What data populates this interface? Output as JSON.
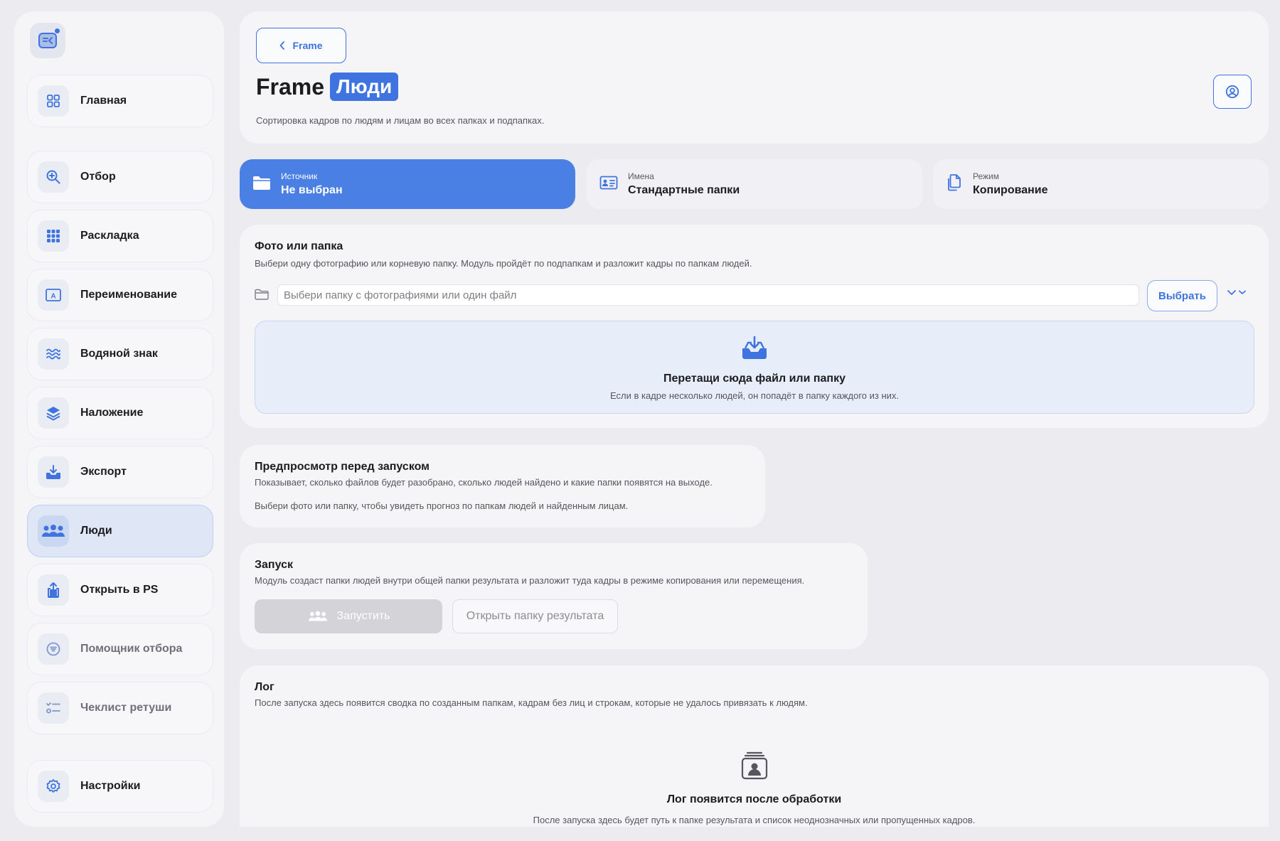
{
  "sidebar": {
    "items": [
      {
        "label": "Главная"
      },
      {
        "label": "Отбор"
      },
      {
        "label": "Раскладка"
      },
      {
        "label": "Переименование"
      },
      {
        "label": "Водяной знак"
      },
      {
        "label": "Наложение"
      },
      {
        "label": "Экспорт"
      },
      {
        "label": "Люди"
      },
      {
        "label": "Открыть в PS"
      },
      {
        "label": "Помощник отбора"
      },
      {
        "label": "Чеклист ретуши"
      },
      {
        "label": "Настройки"
      }
    ],
    "active_item": "Люди"
  },
  "header": {
    "back_label": "Frame",
    "title_main": "Frame",
    "title_badge": "Люди",
    "subtitle": "Сортировка кадров по людям и лицам во всех папках и подпапках."
  },
  "tiles": [
    {
      "caption": "Источник",
      "value": "Не выбран"
    },
    {
      "caption": "Имена",
      "value": "Стандартные папки"
    },
    {
      "caption": "Режим",
      "value": "Копирование"
    }
  ],
  "source": {
    "title": "Фото или папка",
    "description": "Выбери одну фотографию или корневую папку. Модуль пройдёт по подпапкам и разложит кадры по папкам людей.",
    "input_value": "",
    "input_placeholder": "Выбери папку с фотографиями или один файл",
    "choose_label": "Выбрать",
    "dropzone_title": "Перетащи сюда файл или папку",
    "dropzone_desc": "Если в кадре несколько людей, он попадёт в папку каждого из них."
  },
  "preview": {
    "title": "Предпросмотр перед запуском",
    "description": "Показывает, сколько файлов будет разобрано, сколько людей найдено и какие папки появятся на выходе.",
    "hint": "Выбери фото или папку, чтобы увидеть прогноз по папкам людей и найденным лицам."
  },
  "launch": {
    "title": "Запуск",
    "description": "Модуль создаст папки людей внутри общей папки результата и разложит туда кадры в режиме копирования или перемещения.",
    "run_label": "Запустить",
    "open_label": "Открыть папку результата"
  },
  "log": {
    "title": "Лог",
    "description": "После запуска здесь появится сводка по созданным папкам, кадрам без лиц и строкам, которые не удалось привязать к людям.",
    "empty_title": "Лог появится после обработки",
    "empty_desc": "После запуска здесь будет путь к папке результата и список неоднозначных или пропущенных кадров."
  },
  "colors": {
    "accent": "#3f74e0",
    "tile_primary": "#4a7fe3",
    "active_nav_bg": "#dfe7f6",
    "dropzone_bg": "#e8eef9"
  }
}
